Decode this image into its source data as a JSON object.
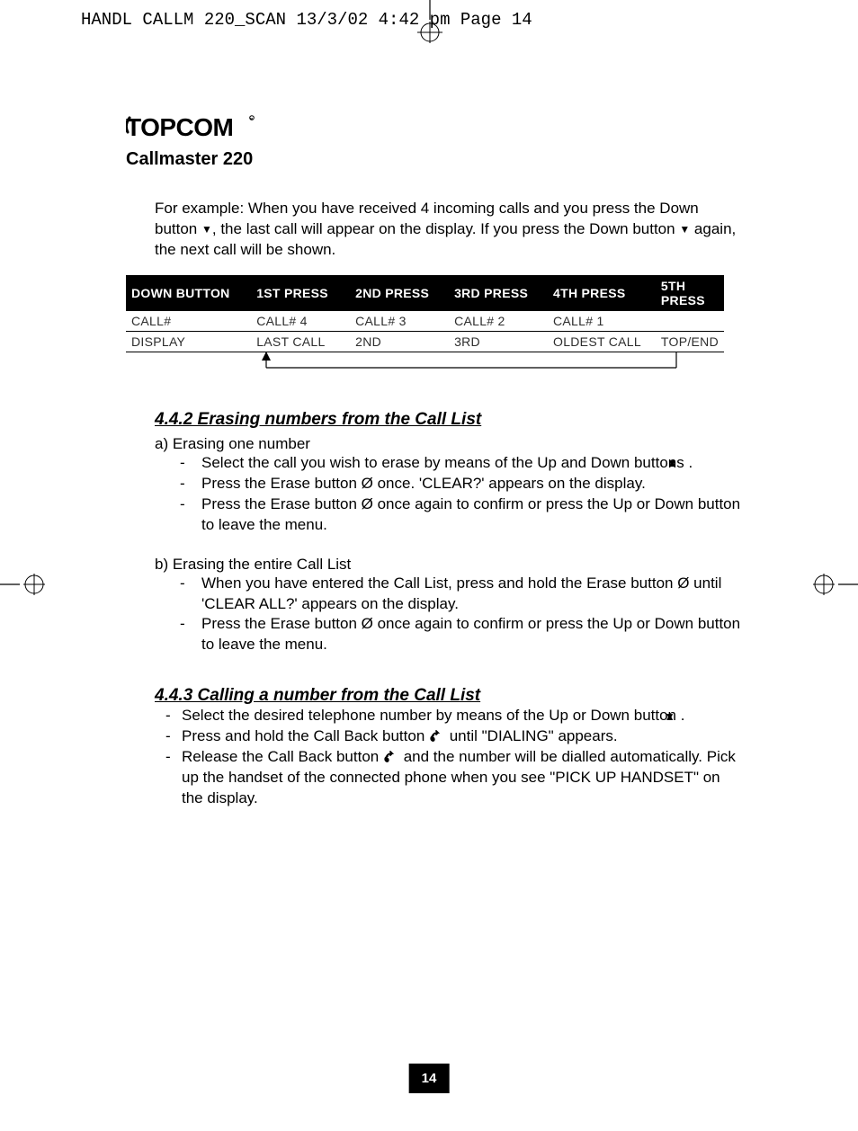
{
  "printer_slug": "HANDL CALLM 220_SCAN  13/3/02  4:42 pm  Page 14",
  "brand": "TOPCOM",
  "product": "Callmaster 220",
  "intro_text_1": "For example: When you have received 4 incoming calls and you press the Down button ",
  "intro_text_2": ", the last call will appear on the display. If you press the Down button ",
  "intro_text_3": " again, the next call will be shown.",
  "table": {
    "headers": [
      "DOWN BUTTON",
      "1ST PRESS",
      "2ND PRESS",
      "3RD PRESS",
      "4TH PRESS",
      "5TH PRESS"
    ],
    "row1": [
      "CALL#",
      "CALL# 4",
      "CALL# 3",
      "CALL# 2",
      "CALL# 1",
      ""
    ],
    "row2": [
      "DISPLAY",
      "LAST CALL",
      "2ND",
      "3RD",
      "OLDEST CALL",
      "TOP/END"
    ]
  },
  "s442_h": "4.4.2 Erasing numbers from the Call List",
  "s442_a": "a) Erasing one number",
  "s442_a1a": "Select the call you wish to erase by means of the Up and Down buttons ",
  "s442_a1b": ".",
  "s442_a2": "Press the Erase button Ø once. 'CLEAR?' appears on the display.",
  "s442_a3": "Press the Erase button Ø once again to confirm or press the Up or Down button to leave the menu.",
  "s442_b": "b) Erasing the entire Call List",
  "s442_b1": "When you have entered the Call List, press and hold the Erase button Ø until 'CLEAR ALL?' appears on the display.",
  "s442_b2": "Press the Erase button Ø once again to confirm or press the Up or Down button to leave the menu.",
  "s443_h": "4.4.3 Calling a number from the Call List",
  "s443_1a": "Select the desired telephone number by means of the Up or Down button ",
  "s443_1b": ".",
  "s443_2a": "Press and hold the Call Back button  ",
  "s443_2b": "  until \"DIALING\" appears.",
  "s443_3a": "Release the Call Back button  ",
  "s443_3b": "  and the number will be dialled automatically. Pick up the handset of the connected phone when you see \"PICK UP HANDSET\" on the display.",
  "page_number": "14"
}
